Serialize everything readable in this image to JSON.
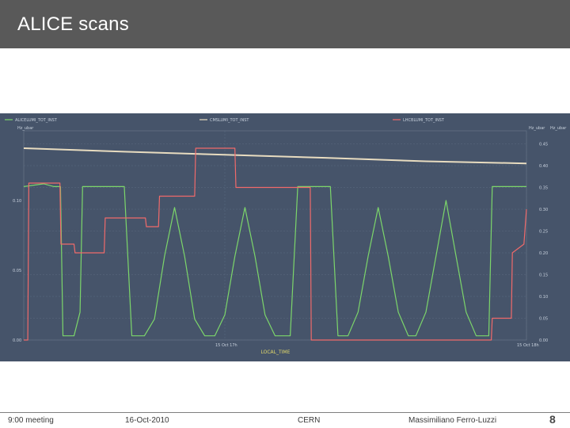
{
  "slide": {
    "title": "ALICE scans",
    "footer": {
      "meeting": "9:00 meeting",
      "date": "16-Oct-2010",
      "organization": "CERN",
      "author": "Massimiliano Ferro-Luzzi",
      "page_number": "8"
    }
  },
  "colors": {
    "title_bar": "#595959",
    "plot_background": "#46546a",
    "alice_series": "#7cd66a",
    "cms_series": "#e8dcc0",
    "lhcb_series": "#f06a6a"
  },
  "chart_data": {
    "type": "line",
    "legend_placement": "top",
    "grid": true,
    "xlabel": "LOCAL_TIME",
    "x_ticks": [
      "15 Oct 17h",
      "15 Oct 18h"
    ],
    "left_axis_label": "Hz_ubar",
    "left_ticks": [
      "0.10",
      "0.05",
      "0.00"
    ],
    "left_ylim": [
      0,
      0.15
    ],
    "right_axis_labels": [
      "Hz_ubar",
      "Hz_ubar"
    ],
    "right_ticks": [
      "0.45",
      "0.40",
      "0.35",
      "0.30",
      "0.25",
      "0.20",
      "0.15",
      "0.10",
      "0.05",
      "0.00"
    ],
    "right_ylim": [
      0,
      0.48
    ],
    "x_domain": [
      0,
      100
    ],
    "series": [
      {
        "name": "ALICELUMI_TOT_INST",
        "axis": "left",
        "points": [
          [
            0,
            0.11
          ],
          [
            4,
            0.112
          ],
          [
            6,
            0.11
          ],
          [
            7.3,
            0.11
          ],
          [
            7.8,
            0.003
          ],
          [
            10,
            0.003
          ],
          [
            11.2,
            0.02
          ],
          [
            11.7,
            0.11
          ],
          [
            20,
            0.11
          ],
          [
            21.5,
            0.003
          ],
          [
            24,
            0.003
          ],
          [
            26,
            0.015
          ],
          [
            28,
            0.06
          ],
          [
            30,
            0.095
          ],
          [
            32,
            0.06
          ],
          [
            34,
            0.015
          ],
          [
            36,
            0.003
          ],
          [
            38,
            0.003
          ],
          [
            40,
            0.018
          ],
          [
            42,
            0.06
          ],
          [
            44,
            0.095
          ],
          [
            46,
            0.06
          ],
          [
            48,
            0.018
          ],
          [
            50,
            0.003
          ],
          [
            53,
            0.003
          ],
          [
            54.5,
            0.11
          ],
          [
            61,
            0.11
          ],
          [
            62.5,
            0.003
          ],
          [
            64.5,
            0.003
          ],
          [
            66.5,
            0.02
          ],
          [
            68.5,
            0.06
          ],
          [
            70.5,
            0.095
          ],
          [
            72.5,
            0.06
          ],
          [
            74.5,
            0.02
          ],
          [
            76.5,
            0.003
          ],
          [
            78,
            0.003
          ],
          [
            80,
            0.02
          ],
          [
            82,
            0.06
          ],
          [
            84,
            0.1
          ],
          [
            86,
            0.06
          ],
          [
            88,
            0.02
          ],
          [
            90,
            0.003
          ],
          [
            92.5,
            0.003
          ],
          [
            93.2,
            0.11
          ],
          [
            100,
            0.11
          ]
        ]
      },
      {
        "name": "CMSLUMI_TOT_INST",
        "axis": "right",
        "points": [
          [
            0,
            0.44
          ],
          [
            20,
            0.432
          ],
          [
            40,
            0.425
          ],
          [
            60,
            0.418
          ],
          [
            80,
            0.41
          ],
          [
            100,
            0.405
          ]
        ]
      },
      {
        "name": "LHCBLUMI_TOT_INST",
        "axis": "right",
        "points": [
          [
            0,
            0.0
          ],
          [
            0.8,
            0.0
          ],
          [
            1.0,
            0.36
          ],
          [
            7.2,
            0.36
          ],
          [
            7.4,
            0.22
          ],
          [
            10,
            0.22
          ],
          [
            10.2,
            0.2
          ],
          [
            16,
            0.2
          ],
          [
            16.2,
            0.28
          ],
          [
            24.2,
            0.28
          ],
          [
            24.4,
            0.26
          ],
          [
            26.8,
            0.26
          ],
          [
            27,
            0.33
          ],
          [
            34,
            0.33
          ],
          [
            34.2,
            0.44
          ],
          [
            42,
            0.44
          ],
          [
            42.2,
            0.35
          ],
          [
            57,
            0.35
          ],
          [
            57.2,
            0.0
          ],
          [
            93,
            0.0
          ],
          [
            93.2,
            0.05
          ],
          [
            97,
            0.05
          ],
          [
            97.2,
            0.2
          ],
          [
            99.5,
            0.22
          ],
          [
            100,
            0.3
          ]
        ]
      }
    ]
  }
}
